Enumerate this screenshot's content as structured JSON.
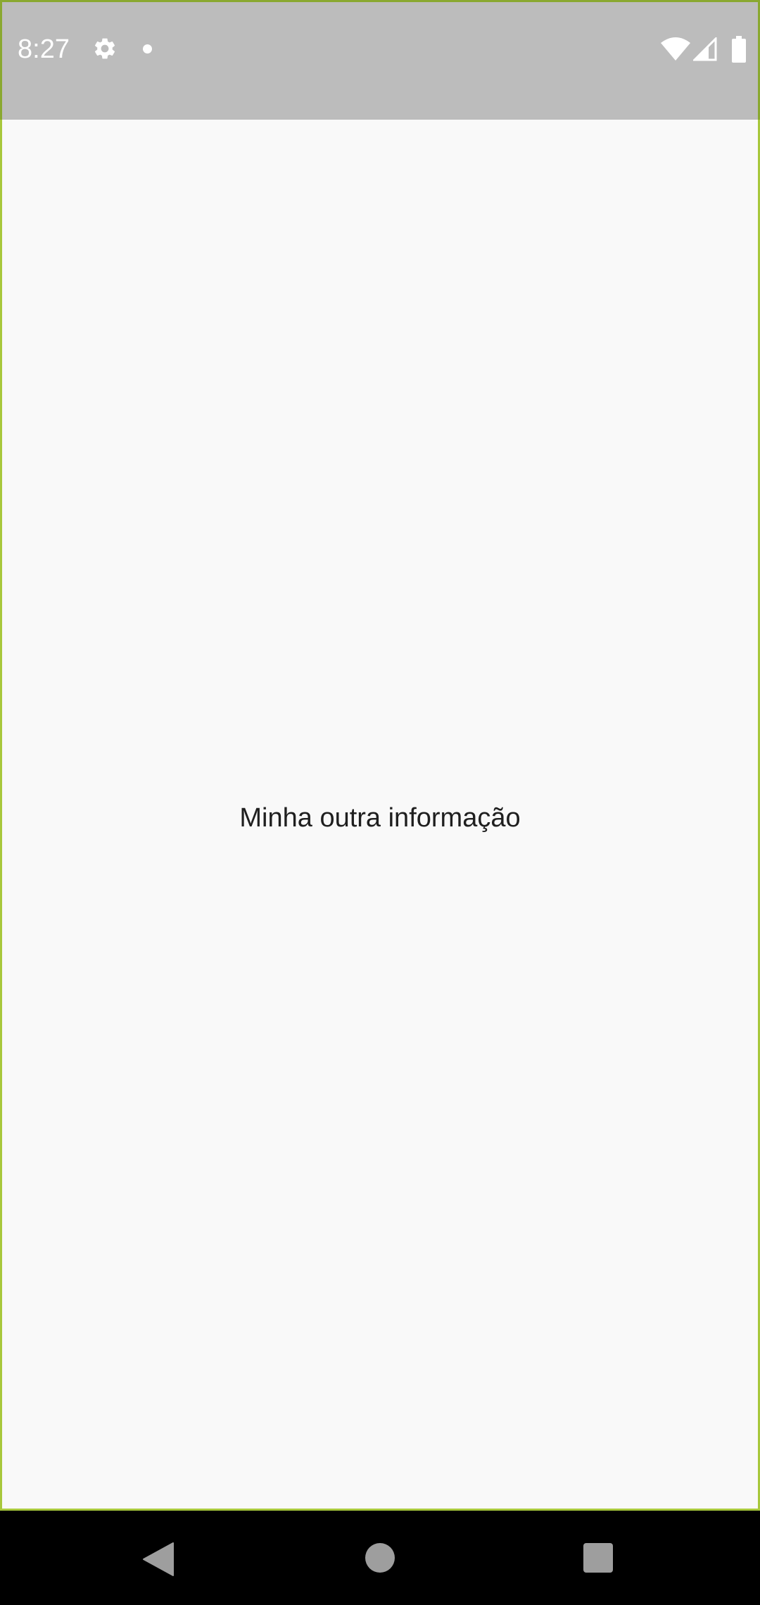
{
  "status_bar": {
    "time": "8:27",
    "icons": [
      "settings-icon",
      "notification-dot-icon",
      "wifi-icon",
      "signal-icon",
      "battery-icon"
    ]
  },
  "main": {
    "text": "Minha outra informação"
  },
  "nav_bar": {
    "buttons": [
      "back-icon",
      "home-icon",
      "recents-icon"
    ]
  },
  "colors": {
    "status_bar_bg": "#bcbcbc",
    "content_bg": "#f9f9f9",
    "frame_border": "#a8c83c",
    "nav_bar_bg": "#000000"
  }
}
